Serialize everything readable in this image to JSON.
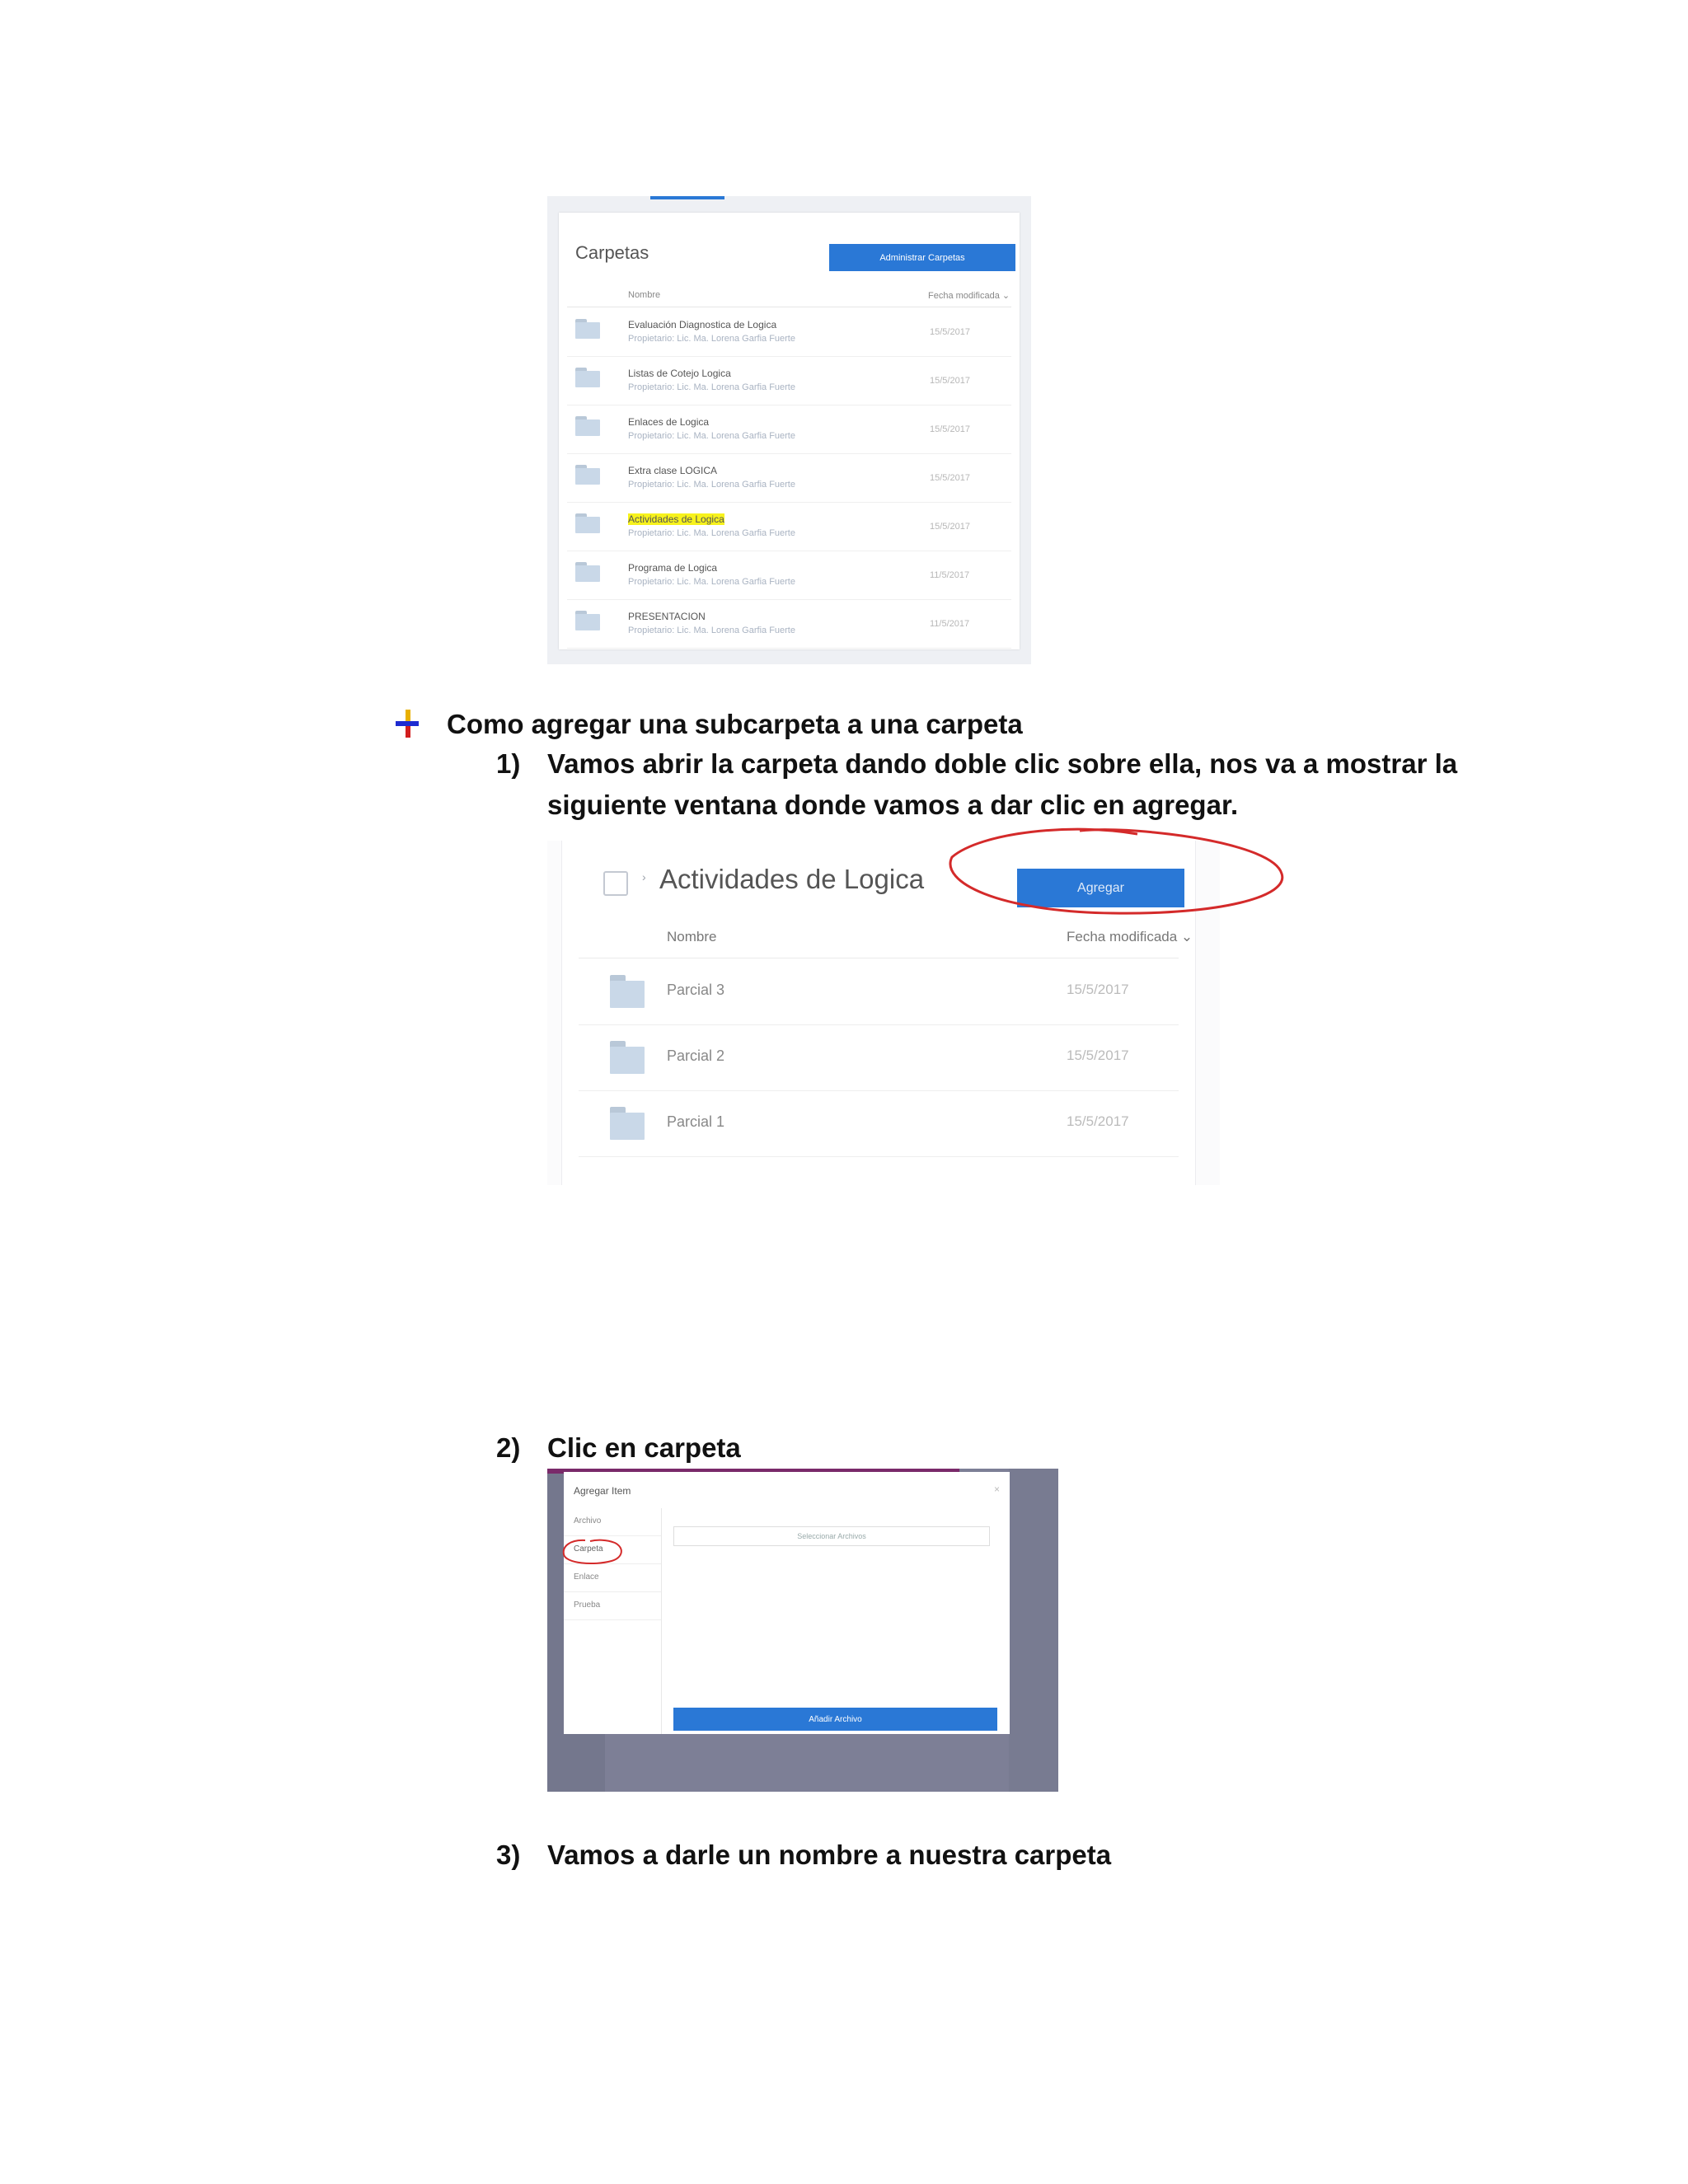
{
  "shot1": {
    "title": "Carpetas",
    "button": "Administrar Carpetas",
    "col_name": "Nombre",
    "col_date": "Fecha modificada ⌄",
    "rows": [
      {
        "name": "Evaluación Diagnostica de Logica",
        "owner": "Propietario: Lic. Ma. Lorena Garfia Fuerte",
        "date": "15/5/2017"
      },
      {
        "name": "Listas de Cotejo Logica",
        "owner": "Propietario: Lic. Ma. Lorena Garfia Fuerte",
        "date": "15/5/2017"
      },
      {
        "name": "Enlaces de Logica",
        "owner": "Propietario: Lic. Ma. Lorena Garfia Fuerte",
        "date": "15/5/2017"
      },
      {
        "name": "Extra clase LOGICA",
        "owner": "Propietario: Lic. Ma. Lorena Garfia Fuerte",
        "date": "15/5/2017"
      },
      {
        "name": "Actividades de Logica",
        "owner": "Propietario: Lic. Ma. Lorena Garfia Fuerte",
        "date": "15/5/2017"
      },
      {
        "name": "Programa de Logica",
        "owner": "Propietario: Lic. Ma. Lorena Garfia Fuerte",
        "date": "11/5/2017"
      },
      {
        "name": "PRESENTACION",
        "owner": "Propietario: Lic. Ma. Lorena Garfia Fuerte",
        "date": "11/5/2017"
      }
    ]
  },
  "doc": {
    "section_title": "Como agregar una subcarpeta a una carpeta",
    "step1_num": "1)",
    "step1_line1": "Vamos abrir la carpeta dando doble clic sobre ella, nos va a mostrar la",
    "step1_line2": "siguiente ventana donde vamos a dar clic en agregar.",
    "step2_num": "2)",
    "step2_text": "Clic en carpeta",
    "step3_num": "3)",
    "step3_text": "Vamos a darle un nombre a nuestra carpeta"
  },
  "shot2": {
    "title": "Actividades de Logica",
    "button": "Agregar",
    "col_name": "Nombre",
    "col_date": "Fecha modificada ⌄",
    "rows": [
      {
        "name": "Parcial 3",
        "date": "15/5/2017"
      },
      {
        "name": "Parcial 2",
        "date": "15/5/2017"
      },
      {
        "name": "Parcial 1",
        "date": "15/5/2017"
      }
    ]
  },
  "shot3": {
    "title": "Agregar Item",
    "close": "×",
    "side_items": [
      "Archivo",
      "Carpeta",
      "Enlace",
      "Prueba"
    ],
    "select_placeholder": "Seleccionar Archivos",
    "add_button": "Añadir Archivo"
  },
  "colors": {
    "accent": "#2a78d6",
    "highlight": "#f7f21c",
    "annotation": "#d42a2a"
  }
}
